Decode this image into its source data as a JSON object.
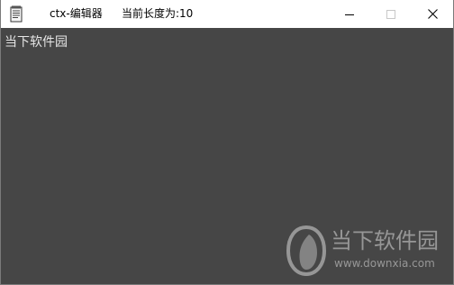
{
  "window": {
    "title": "ctx-编辑器",
    "length_status": "当前长度为:10"
  },
  "editor": {
    "content": "当下软件园"
  },
  "watermark": {
    "brand": "当下软件园",
    "url": "www.downxia.com"
  },
  "icons": {
    "app": "notepad-icon",
    "minimize": "minimize-icon",
    "maximize": "maximize-icon",
    "close": "close-icon"
  },
  "colors": {
    "editor_background": "#464646",
    "editor_text": "#e6e6e6",
    "titlebar_background": "#ffffff"
  }
}
